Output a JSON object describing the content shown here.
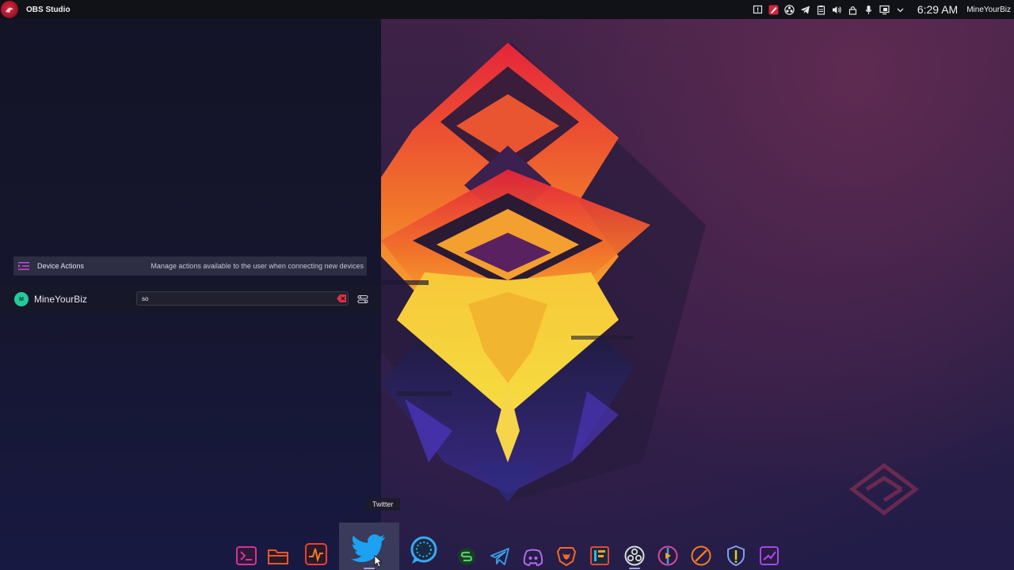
{
  "topbar": {
    "app_title": "OBS Studio",
    "clock": "6:29 AM",
    "user": "MineYourBiz",
    "tray_icons": [
      "notification-icon",
      "pen-icon",
      "obs-icon",
      "telegram-icon",
      "clipboard-icon",
      "volume-icon",
      "lock-icon",
      "microphone-icon",
      "display-icon",
      "chevron-down-icon"
    ]
  },
  "device_actions": {
    "title": "Device Actions",
    "description": "Manage actions available to the user when connecting new devices"
  },
  "user_row": {
    "avatar_text": "M",
    "name": "MineYourBiz",
    "input_value": "so"
  },
  "tooltip": "Twitter",
  "dock": {
    "items": [
      "terminal",
      "files",
      "system-monitor",
      "twitter",
      "steam-chat",
      "app-s",
      "telegram",
      "discord",
      "brave",
      "app-store",
      "obs",
      "multimedia",
      "compass",
      "security",
      "steam"
    ]
  },
  "colors": {
    "accent_red": "#e0283f",
    "twitter_blue": "#1da1f2",
    "panel_bg": "#2d2d44"
  }
}
